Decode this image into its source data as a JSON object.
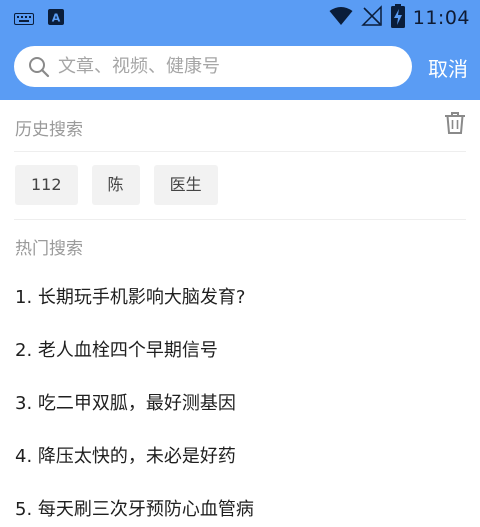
{
  "status_bar": {
    "time": "11:04",
    "icons": [
      "keyboard-icon",
      "app-a-icon",
      "wifi-icon",
      "no-signal-icon",
      "battery-charging-icon"
    ],
    "app_icon_letter": "A"
  },
  "search": {
    "placeholder": "文章、视频、健康号",
    "value": "",
    "cancel_label": "取消"
  },
  "history": {
    "title": "历史搜索",
    "clear_icon": "trash-icon",
    "tags": [
      "112",
      "陈",
      "医生"
    ]
  },
  "hot": {
    "title": "热门搜索",
    "items": [
      "1. 长期玩手机影响大脑发育?",
      "2. 老人血栓四个早期信号",
      "3. 吃二甲双胍，最好测基因",
      "4. 降压太快的，未必是好药",
      "5. 每天刷三次牙预防心血管病"
    ]
  },
  "colors": {
    "header_bg": "#5a9cf4",
    "search_bg": "#ffffff",
    "section_title": "#9a9a9a",
    "tag_bg": "#f2f2f2"
  }
}
